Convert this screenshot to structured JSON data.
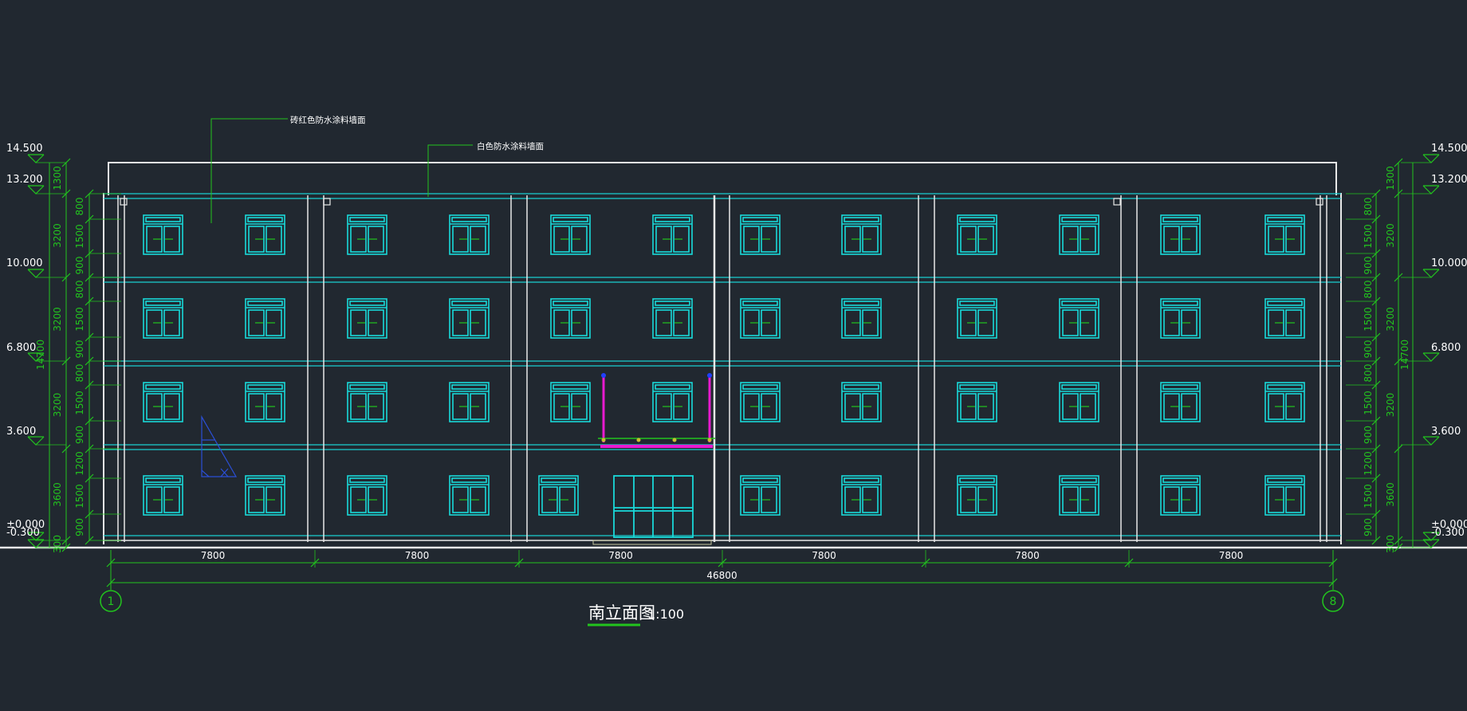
{
  "drawing": {
    "title": "南立面图",
    "scale": "1:100",
    "colors": {
      "background": "#212830",
      "dimension": "#22c41e",
      "outline": "#e8e8e8",
      "window": "#19d9d9",
      "floor_line": "#19cfcf",
      "accent": "#e81ad0",
      "annotation": "#ffffff"
    },
    "annotations": [
      "砖红色防水涂料墙面",
      "白色防水涂料墙面"
    ],
    "levels_left": [
      "14.500",
      "13.200",
      "10.000",
      "6.800",
      "3.600",
      "±0.000",
      "-0.300"
    ],
    "levels_right": [
      "14.500",
      "13.200",
      "10.000",
      "6.800",
      "3.600",
      "±0.000",
      "-0.300"
    ],
    "vertical_dims_outer": [
      "1300",
      "3200",
      "3200",
      "3200",
      "3600",
      "300"
    ],
    "vertical_dims_inner": [
      "800",
      "1500",
      "900",
      "800",
      "1500",
      "900",
      "800",
      "1500",
      "900",
      "1200",
      "1500",
      "900"
    ],
    "total_height": "14700",
    "bay_dims": [
      "7800",
      "7800",
      "7800",
      "7800",
      "7800",
      "7800"
    ],
    "total_width": "46800",
    "axis_labels": [
      "1",
      "8"
    ]
  }
}
